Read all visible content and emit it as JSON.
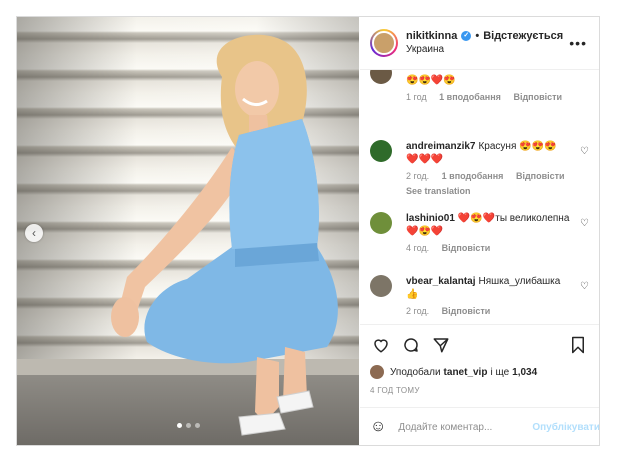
{
  "header": {
    "username": "nikitkinna",
    "separator": "•",
    "follow_label": "Відстежується",
    "location": "Украина",
    "more_label": "•••"
  },
  "photo": {
    "prev_label": "‹"
  },
  "comments": [
    {
      "user": "",
      "text": "😍😍❤️😍",
      "time": "1 год",
      "likes": "1 вподобання",
      "reply": "Відповісти",
      "avatar_color": "#6b5a45",
      "partial": true
    },
    {
      "user": "andreimanzik7",
      "text": "Красуня 😍😍😍 ❤️❤️❤️",
      "time": "2 год.",
      "likes": "1 вподобання",
      "reply": "Відповісти",
      "see_translation": "See translation",
      "avatar_color": "#2f6b2a"
    },
    {
      "user": "lashinio01",
      "text": "❤️😍❤️ты великолепна❤️😍❤️",
      "time": "4 год.",
      "reply": "Відповісти",
      "avatar_color": "#6f8f3a"
    },
    {
      "user": "vbear_kalantaj",
      "text": "Няшка_улибашка 👍",
      "time": "2 год.",
      "reply": "Відповісти",
      "avatar_color": "#7d7567"
    }
  ],
  "likes": {
    "prefix": "Уподобали",
    "user": "tanet_vip",
    "middle": "і ще",
    "count": "1,034"
  },
  "timestamp": "4 ГОД ТОМУ",
  "add_comment": {
    "placeholder": "Додайте коментар...",
    "publish_label": "Опублікувати"
  }
}
